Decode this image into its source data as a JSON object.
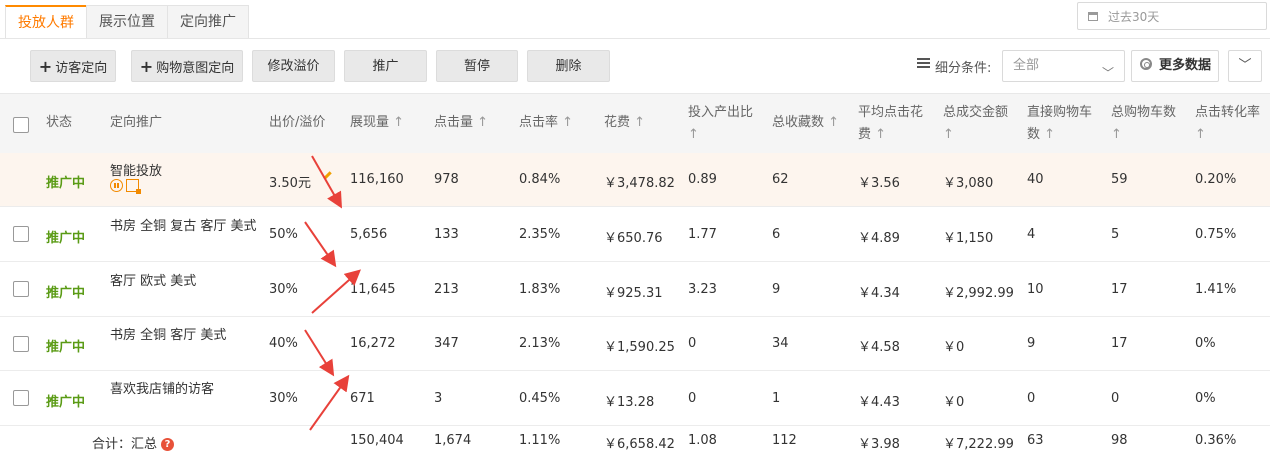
{
  "tabs": [
    {
      "label": "投放人群",
      "active": true
    },
    {
      "label": "展示位置",
      "active": false
    },
    {
      "label": "定向推广",
      "active": false
    }
  ],
  "date_range": {
    "label": "过去30天"
  },
  "toolbar": {
    "visitor_targeting": "访客定向",
    "purchase_intent_targeting": "购物意图定向",
    "modify_premium": "修改溢价",
    "promote": "推广",
    "pause": "暂停",
    "delete": "删除"
  },
  "filter": {
    "label": "细分条件:",
    "select_value": "全部"
  },
  "more_data": "更多数据",
  "columns": {
    "status": "状态",
    "targeting": "定向推广",
    "bid": "出价/溢价",
    "impressions": "展现量",
    "clicks": "点击量",
    "ctr": "点击率",
    "cost": "花费",
    "roi": "投入产出比",
    "favorites": "总收藏数",
    "avg_cpc_line1": "平均点击花",
    "avg_cpc_line2": "费",
    "gmv": "总成交金额",
    "direct_cart_line1": "直接购物车",
    "direct_cart_line2": "数",
    "total_cart": "总购物车数",
    "cvr": "点击转化率",
    "sort_arrow": "↑"
  },
  "rows": [
    {
      "status": "推广中",
      "name": "智能投放",
      "bid": "3.50元",
      "impressions": "116,160",
      "clicks": "978",
      "ctr": "0.84%",
      "cost": "￥3,478.82",
      "roi": "0.89",
      "favorites": "62",
      "avg_cpc": "￥3.56",
      "gmv": "￥3,080",
      "direct_cart": "40",
      "total_cart": "59",
      "cvr": "0.20%"
    },
    {
      "status": "推广中",
      "name": "书房 全铜 复古 客厅 美式",
      "bid": "50%",
      "impressions": "5,656",
      "clicks": "133",
      "ctr": "2.35%",
      "cost": "￥650.76",
      "roi": "1.77",
      "favorites": "6",
      "avg_cpc": "￥4.89",
      "gmv": "￥1,150",
      "direct_cart": "4",
      "total_cart": "5",
      "cvr": "0.75%"
    },
    {
      "status": "推广中",
      "name": "客厅 欧式 美式",
      "bid": "30%",
      "impressions": "11,645",
      "clicks": "213",
      "ctr": "1.83%",
      "cost": "￥925.31",
      "roi": "3.23",
      "favorites": "9",
      "avg_cpc": "￥4.34",
      "gmv": "￥2,992.99",
      "direct_cart": "10",
      "total_cart": "17",
      "cvr": "1.41%"
    },
    {
      "status": "推广中",
      "name": "书房 全铜 客厅 美式",
      "bid": "40%",
      "impressions": "16,272",
      "clicks": "347",
      "ctr": "2.13%",
      "cost": "￥1,590.25",
      "roi": "0",
      "favorites": "34",
      "avg_cpc": "￥4.58",
      "gmv": "￥0",
      "direct_cart": "9",
      "total_cart": "17",
      "cvr": "0%"
    },
    {
      "status": "推广中",
      "name": "喜欢我店铺的访客",
      "bid": "30%",
      "impressions": "671",
      "clicks": "3",
      "ctr": "0.45%",
      "cost": "￥13.28",
      "roi": "0",
      "favorites": "1",
      "avg_cpc": "￥4.43",
      "gmv": "￥0",
      "direct_cart": "0",
      "total_cart": "0",
      "cvr": "0%"
    }
  ],
  "totals": {
    "label": "合计：汇总",
    "help": "?",
    "impressions": "150,404",
    "clicks": "1,674",
    "ctr": "1.11%",
    "cost": "￥6,658.42",
    "roi": "1.08",
    "favorites": "112",
    "avg_cpc": "￥3.98",
    "gmv": "￥7,222.99",
    "direct_cart": "63",
    "total_cart": "98",
    "cvr": "0.36%"
  },
  "colors": {
    "accent": "#ff7b00",
    "status_green": "#5a9b15",
    "arrow_red": "#e8413a",
    "highlight_row": "#fdf5ee"
  }
}
